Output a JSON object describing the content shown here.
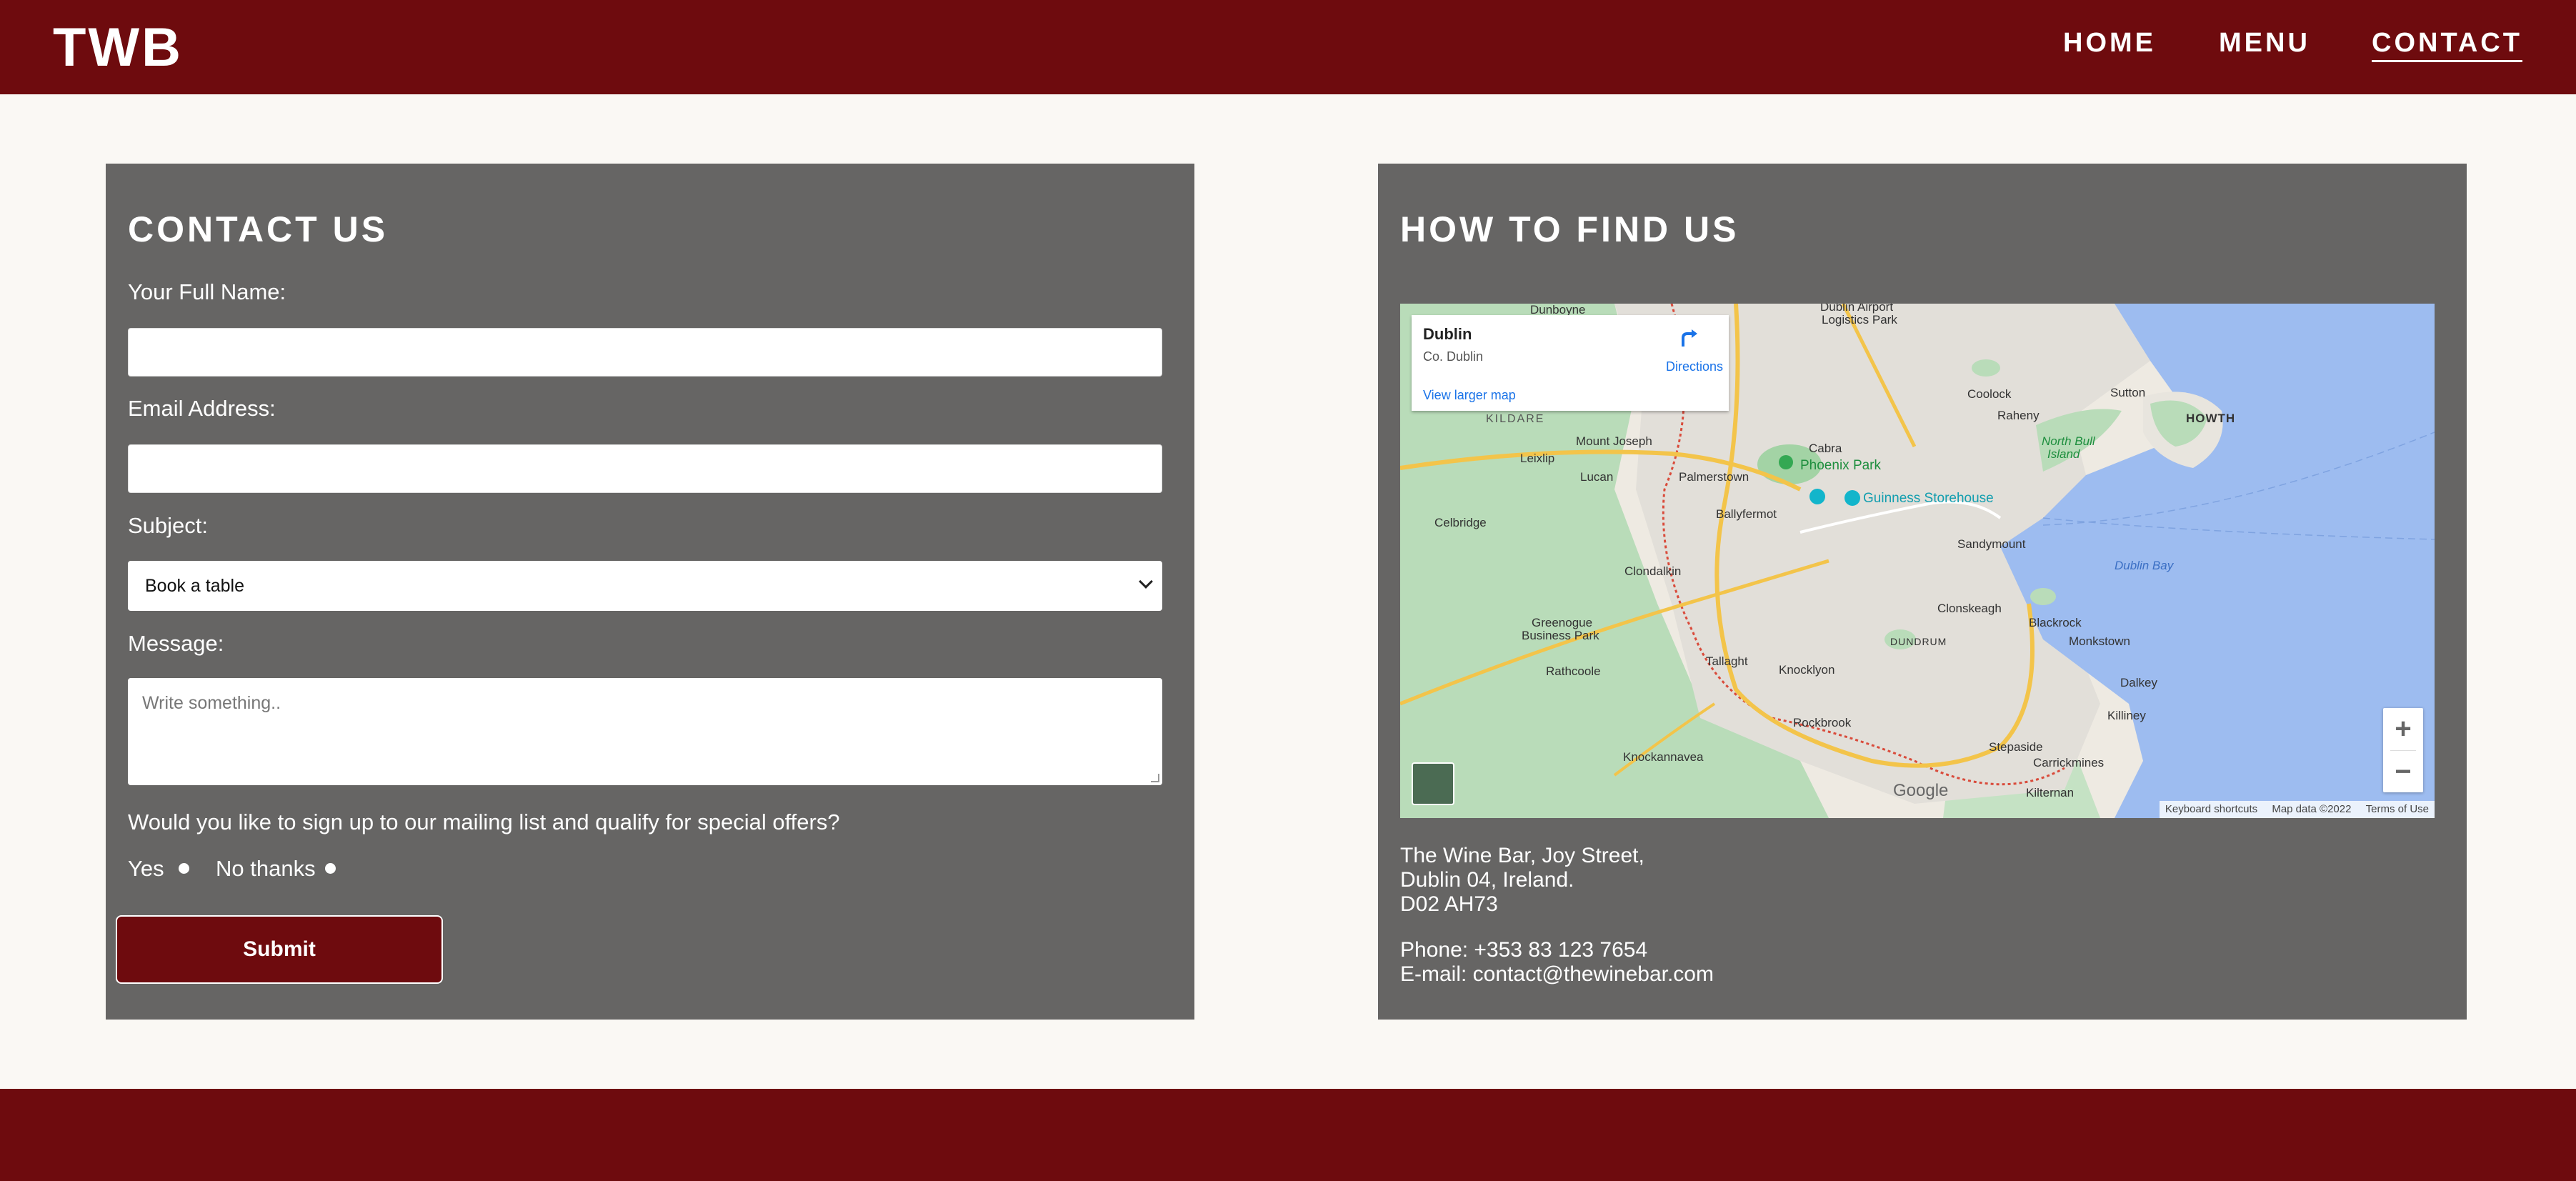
{
  "brand": {
    "logo": "TWB"
  },
  "nav": {
    "items": [
      "HOME",
      "MENU",
      "CONTACT"
    ],
    "active": "CONTACT"
  },
  "contact": {
    "title": "CONTACT US",
    "name_label": "Your Full Name:",
    "email_label": "Email Address:",
    "subject_label": "Subject:",
    "subject_value": "Book a table",
    "message_label": "Message:",
    "message_placeholder": "Write something..",
    "mailing_question": "Would you like to sign up to our mailing list and qualify for special offers?",
    "yes_label": "Yes",
    "no_label": "No thanks",
    "submit_label": "Submit"
  },
  "find": {
    "title": "HOW TO FIND US",
    "map": {
      "place": "Dublin",
      "region": "Co. Dublin",
      "directions": "Directions",
      "larger_map": "View larger map",
      "zoom_in": "+",
      "zoom_out": "−",
      "google": "Google",
      "footer": [
        "Keyboard shortcuts",
        "Map data ©2022",
        "Terms of Use"
      ],
      "labels": {
        "dunboyne": "Dunboyne",
        "airport": "Dublin Airport",
        "logistics": "Logistics Park",
        "kildare": "KILDARE",
        "mount_joseph": "Mount Joseph",
        "leixlip": "Leixlip",
        "lucan": "Lucan",
        "palmerstown": "Palmerstown",
        "cabra": "Cabra",
        "phoenix": "Phoenix Park",
        "guinness": "Guinness Storehouse",
        "ballyfermot": "Ballyfermot",
        "celbridge": "Celbridge",
        "clondalkin": "Clondalkin",
        "greenogue": "Greenogue",
        "business_park": "Business Park",
        "rathcoole": "Rathcoole",
        "tallaght": "Tallaght",
        "knocklyon": "Knocklyon",
        "rockbrook": "Rockbrook",
        "knockannavea": "Knockannavea",
        "stepaside": "Stepaside",
        "carrickmines": "Carrickmines",
        "kilternan": "Kilternan",
        "coolock": "Coolock",
        "raheny": "Raheny",
        "sutton": "Sutton",
        "howth": "HOWTH",
        "north_bull": "North Bull",
        "island": "Island",
        "sandymount": "Sandymount",
        "dublin_bay": "Dublin Bay",
        "clonskeagh": "Clonskeagh",
        "blackrock": "Blackrock",
        "monkstown": "Monkstown",
        "dundrum": "DUNDRUM",
        "dalkey": "Dalkey",
        "killiney": "Killiney"
      }
    },
    "address": [
      "The Wine Bar, Joy Street,",
      "Dublin 04, Ireland.",
      "D02 AH73"
    ],
    "phone": "Phone: +353 83 123 7654",
    "email": "E-mail: contact@thewinebar.com"
  },
  "colors": {
    "brand": "#6e0b0e",
    "panel": "#666564",
    "background": "#faf8f4",
    "link": "#1a73e8"
  }
}
